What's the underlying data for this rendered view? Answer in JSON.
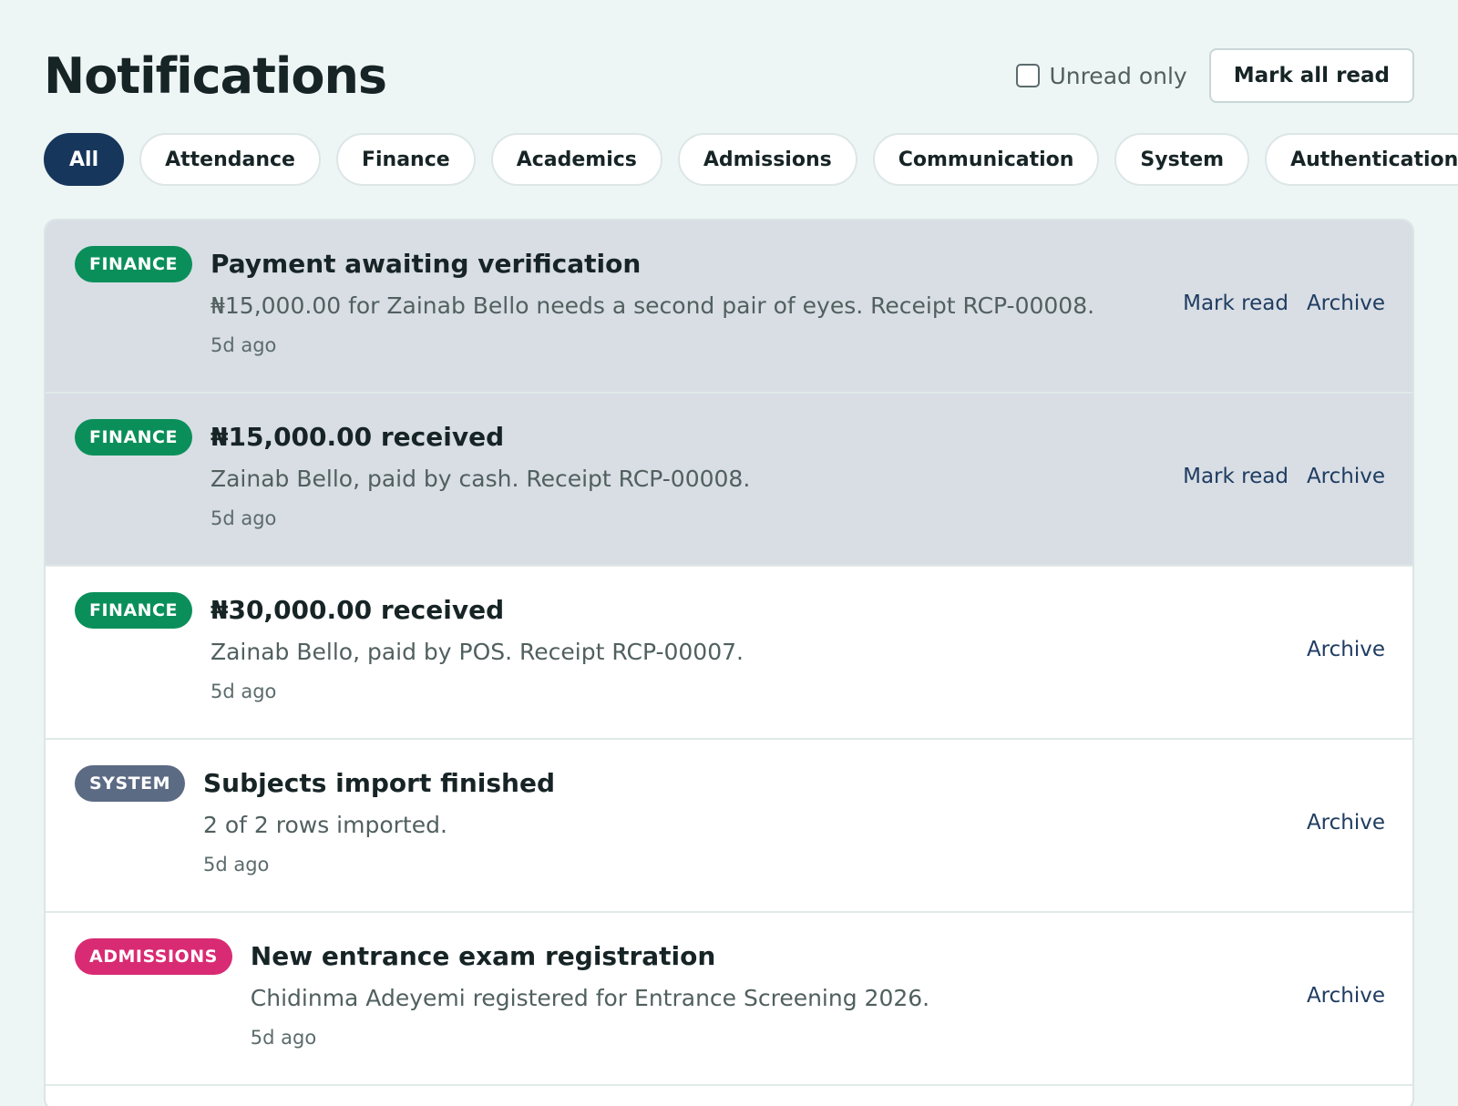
{
  "page": {
    "title": "Notifications",
    "unread_only_label": "Unread only",
    "unread_only_checked": false,
    "mark_all_read_label": "Mark all read"
  },
  "filters": [
    {
      "label": "All",
      "active": true
    },
    {
      "label": "Attendance",
      "active": false
    },
    {
      "label": "Finance",
      "active": false
    },
    {
      "label": "Academics",
      "active": false
    },
    {
      "label": "Admissions",
      "active": false
    },
    {
      "label": "Communication",
      "active": false
    },
    {
      "label": "System",
      "active": false
    },
    {
      "label": "Authentication",
      "active": false
    }
  ],
  "notifications": [
    {
      "badge": "FINANCE",
      "badge_color": "#0b8f5a",
      "title": "Payment awaiting verification",
      "text": "₦15,000.00 for Zainab Bello needs a second pair of eyes. Receipt RCP-00008.",
      "time": "5d ago",
      "unread": true,
      "mark_read_label": "Mark read",
      "archive_label": "Archive"
    },
    {
      "badge": "FINANCE",
      "badge_color": "#0b8f5a",
      "title": "₦15,000.00 received",
      "text": "Zainab Bello, paid by cash. Receipt RCP-00008.",
      "time": "5d ago",
      "unread": true,
      "mark_read_label": "Mark read",
      "archive_label": "Archive"
    },
    {
      "badge": "FINANCE",
      "badge_color": "#0b8f5a",
      "title": "₦30,000.00 received",
      "text": "Zainab Bello, paid by POS. Receipt RCP-00007.",
      "time": "5d ago",
      "unread": false,
      "archive_label": "Archive"
    },
    {
      "badge": "SYSTEM",
      "badge_color": "#5c6b84",
      "title": "Subjects import finished",
      "text": "2 of 2 rows imported.",
      "time": "5d ago",
      "unread": false,
      "archive_label": "Archive"
    },
    {
      "badge": "ADMISSIONS",
      "badge_color": "#d92b73",
      "title": "New entrance exam registration",
      "text": "Chidinma Adeyemi registered for Entrance Screening 2026.",
      "time": "5d ago",
      "unread": false,
      "archive_label": "Archive"
    }
  ]
}
